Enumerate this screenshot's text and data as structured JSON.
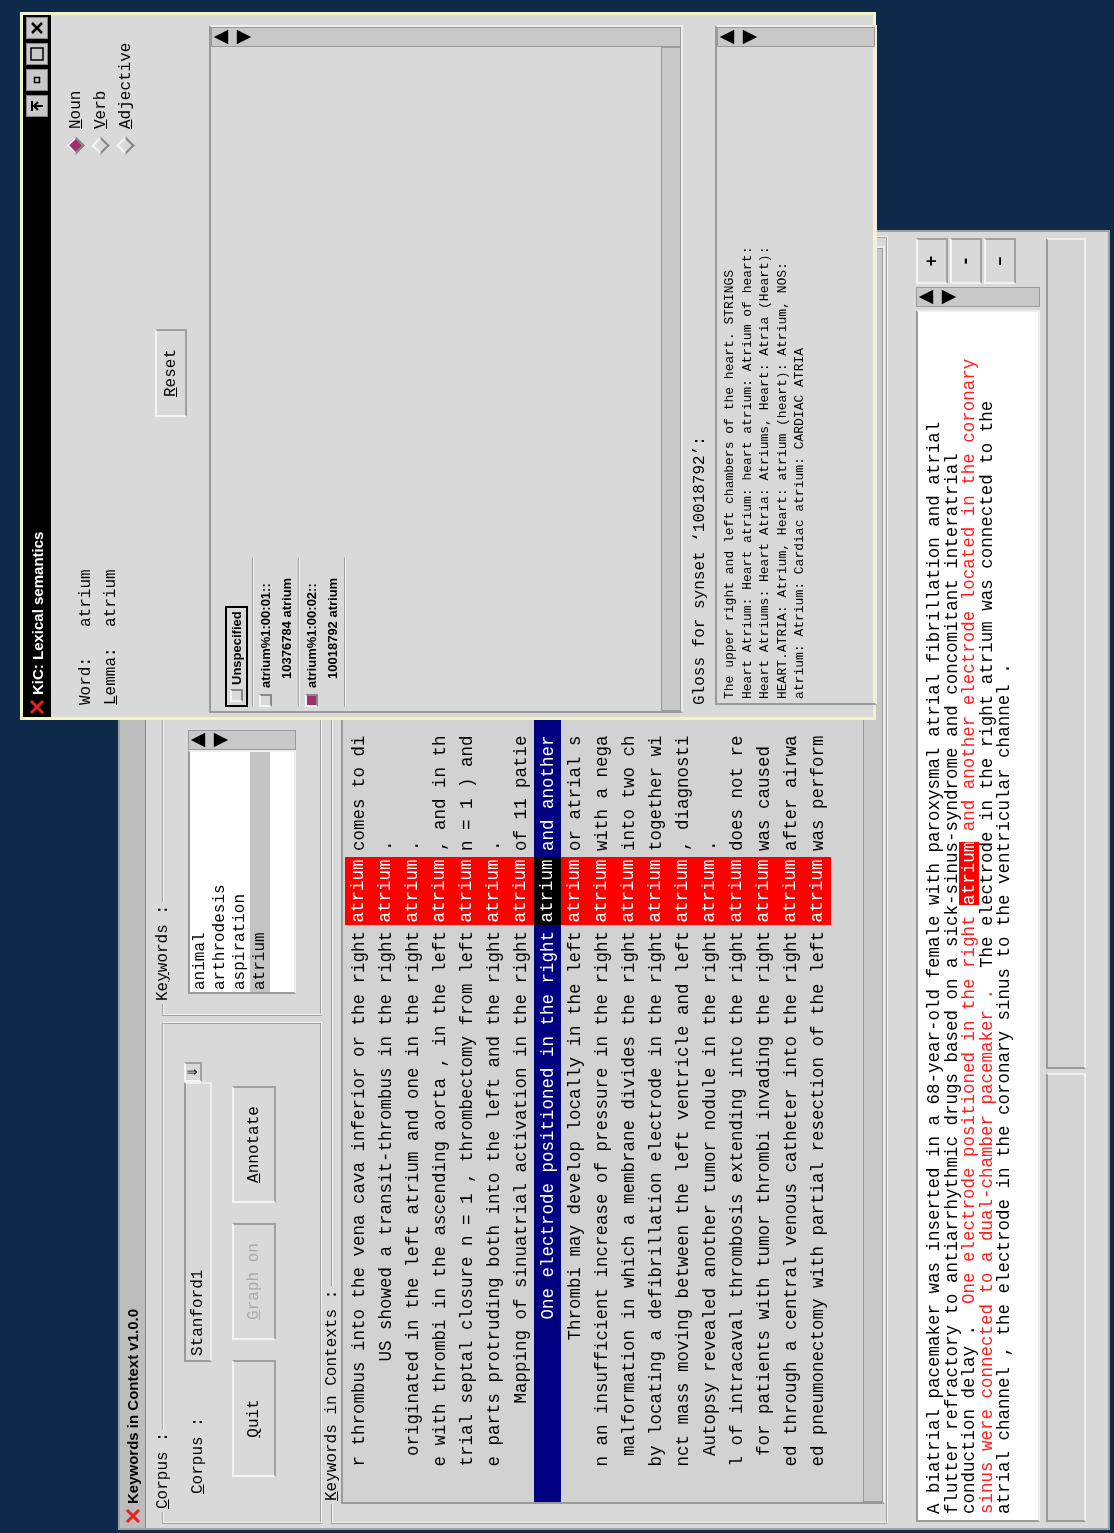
{
  "main_window": {
    "title": "Keywords in Context v1.0.0",
    "corpus_group": {
      "label": {
        "key": "C",
        "post": "orpus :"
      },
      "field_label": {
        "key": "C",
        "post": "orpus :"
      },
      "value": "Stanford1",
      "dropdown_glyph": "⇓"
    },
    "buttons": [
      {
        "label": {
          "key": "Q",
          "post": "uit"
        },
        "disabled": false
      },
      {
        "label": {
          "key": "G",
          "post": "raph on"
        },
        "disabled": true
      },
      {
        "label": {
          "key": "A",
          "post": "nnotate"
        },
        "disabled": false
      }
    ],
    "keywords_group": {
      "label": {
        "pre": "Ke",
        "key": "y",
        "post": "words :"
      },
      "items": [
        {
          "text": "animal",
          "selected": false
        },
        {
          "text": "arthrodesis",
          "selected": false
        },
        {
          "text": "aspiration",
          "selected": false
        },
        {
          "text": "atrium",
          "selected": true
        }
      ]
    },
    "contexts_group": {
      "label": {
        "key": "K",
        "post": "eywords in Contexts :"
      },
      "rows": [
        {
          "left": "r thrombus into the vena cava inferior or the right",
          "keyword": "atrium",
          "right": "comes to di",
          "selected": false
        },
        {
          "left": "US showed a transit-thrombus in the right",
          "keyword": "atrium",
          "right": ".",
          "selected": false
        },
        {
          "left": "originated in the left atrium and one in the right",
          "keyword": "atrium",
          "right": ".",
          "selected": false
        },
        {
          "left": "e with thrombi in the ascending aorta , in the left",
          "keyword": "atrium",
          "right": ", and in th",
          "selected": false
        },
        {
          "left": "trial septal closure n = 1 , thrombectomy from left",
          "keyword": "atrium",
          "right": "n = 1 ) and",
          "selected": false
        },
        {
          "left": "e parts protruding both into the left and the right",
          "keyword": "atrium",
          "right": ".",
          "selected": false
        },
        {
          "left": "Mapping of sinuatrial activation in the right",
          "keyword": "atrium",
          "right": "of 11 patie",
          "selected": false
        },
        {
          "left": "One electrode positioned in the right",
          "keyword": "atrium",
          "right": "and another",
          "selected": true
        },
        {
          "left": "Thrombi may develop locally in the left",
          "keyword": "atrium",
          "right": "or atrial s",
          "selected": false
        },
        {
          "left": "n an insufficient increase of pressure in the right",
          "keyword": "atrium",
          "right": "with a nega",
          "selected": false
        },
        {
          "left": "malformation in which a membrane divides the right",
          "keyword": "atrium",
          "right": "into two ch",
          "selected": false
        },
        {
          "left": "by locating a defibrillation electrode in the right",
          "keyword": "atrium",
          "right": "together wi",
          "selected": false
        },
        {
          "left": "nct mass moving between the left ventricle and left",
          "keyword": "atrium",
          "right": ", diagnosti",
          "selected": false
        },
        {
          "left": "Autopsy revealed another tumor nodule in the right",
          "keyword": "atrium",
          "right": ".",
          "selected": false
        },
        {
          "left": "l of intracaval thrombosis extending into the right",
          "keyword": "atrium",
          "right": "does not re",
          "selected": false
        },
        {
          "left": "for patients with tumor thrombi invading the right",
          "keyword": "atrium",
          "right": "was caused",
          "selected": false
        },
        {
          "left": "ed through a central venous catheter into the right",
          "keyword": "atrium",
          "right": "after airwa",
          "selected": false
        },
        {
          "left": "ed pneumonectomy with partial resection of the left",
          "keyword": "atrium",
          "right": "was perform",
          "selected": false
        }
      ]
    },
    "document": {
      "lines": [
        [
          {
            "kind": "plain",
            "text": "A biatrial pacemaker was inserted in a 68-year-old female with paroxysmal atrial fibrillation and atrial"
          }
        ],
        [
          {
            "kind": "plain",
            "text": "flutter refractory to antiarrhythmic drugs based on a sick-sinus-syndrome and concomitant interatrial"
          }
        ],
        [
          {
            "kind": "plain",
            "text": "conduction delay .  "
          },
          {
            "kind": "sentence",
            "text": "One electrode positioned in the right "
          },
          {
            "kind": "keyword",
            "text": "atrium"
          },
          {
            "kind": "sentence",
            "text": " and another electrode located in the coronary"
          }
        ],
        [
          {
            "kind": "sentence",
            "text": "sinus were connected to a dual-chamber pacemaker ."
          },
          {
            "kind": "plain",
            "text": "  The electrode in the right atrium was connected to the"
          }
        ],
        [
          {
            "kind": "plain",
            "text": "atrial channel , the electrode in the coronary sinus to the ventricular channel ."
          }
        ]
      ]
    },
    "zoom_buttons": [
      "+",
      "-",
      "–"
    ]
  },
  "lexical_window": {
    "title": "KiC: Lexical semantics",
    "word_label": "Word:",
    "word": "atrium",
    "lemma_label": {
      "key": "L",
      "post": "emma:"
    },
    "lemma": "atrium",
    "parts_of_speech": [
      {
        "label": {
          "key": "N",
          "post": "oun"
        },
        "selected": true
      },
      {
        "label": {
          "key": "V",
          "post": "erb"
        },
        "selected": false
      },
      {
        "label": {
          "key": "A",
          "post": "djective"
        },
        "selected": false
      }
    ],
    "reset": {
      "label": {
        "key": "R",
        "post": "eset"
      }
    },
    "senses": [
      {
        "kind": "unspecified",
        "label": "Unspecified",
        "checked": false
      },
      {
        "kind": "sense",
        "label": "atrium%1:00:01::",
        "detail": "10376784 atrium",
        "checked": false
      },
      {
        "kind": "sense",
        "label": "atrium%1:00:02::",
        "detail": "10018792 atrium",
        "checked": true
      }
    ],
    "gloss_label": "Gloss for synset ‘10018792’:",
    "gloss_lines": [
      "The upper right and left chambers of the heart. STRINGS",
      "Heart Atrium: Heart atrium: heart atrium: Atrium of heart:",
      "Heart Atriums: Heart Atria: Atriums, Heart: Atria (Heart):",
      "HEART.ATRIA: Atrium, Heart: atrium (heart): Atrium, NOS:",
      "atrium: Atrium: Cardiac atrium: CARDIAC ATRIA"
    ]
  }
}
